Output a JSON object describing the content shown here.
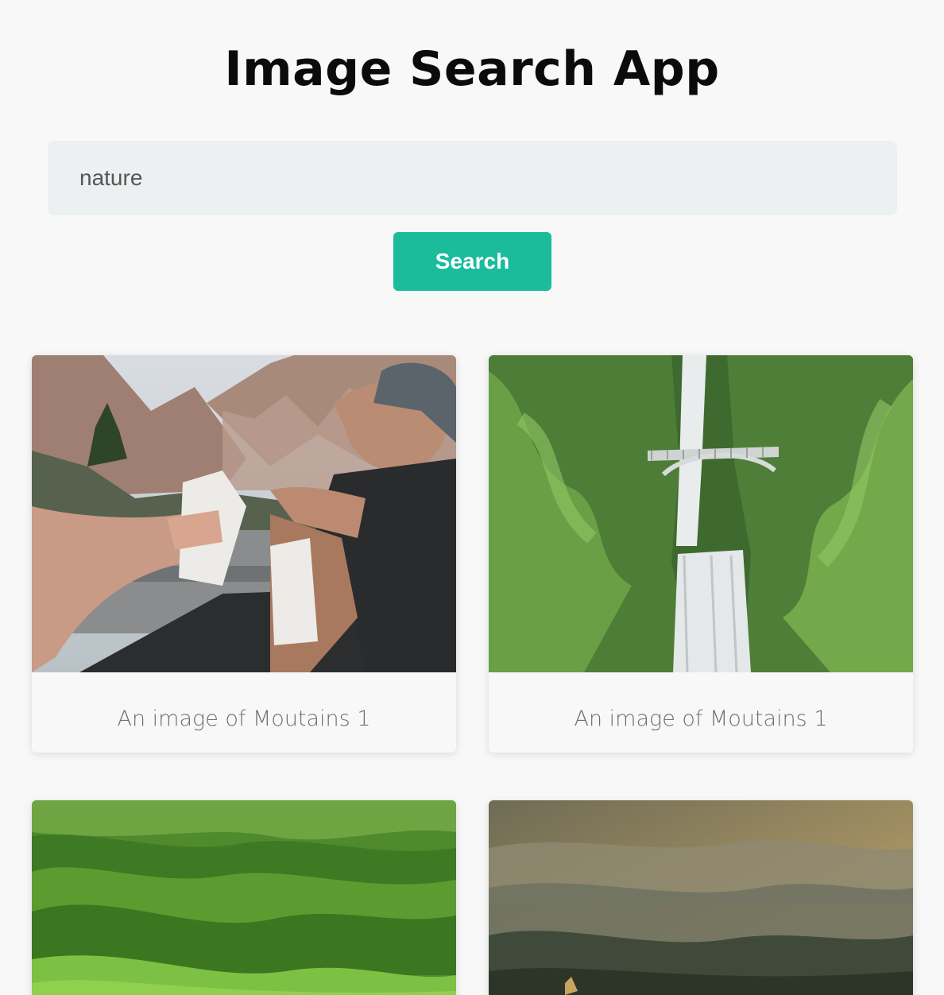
{
  "header": {
    "title": "Image Search App"
  },
  "search": {
    "value": "nature",
    "placeholder": "",
    "button_label": "Search"
  },
  "results": [
    {
      "caption": "An image of Moutains 1",
      "image": "people-with-water-cartons-in-valley"
    },
    {
      "caption": "An image of Moutains 1",
      "image": "waterfall-with-bridge"
    },
    {
      "caption": "",
      "image": "green-rolling-hills"
    },
    {
      "caption": "",
      "image": "misty-mountain-valley"
    }
  ],
  "colors": {
    "background": "#f8f8f8",
    "input_background": "#edf0f1",
    "accent": "#1abc9c",
    "caption_text": "#6f6f6f"
  }
}
